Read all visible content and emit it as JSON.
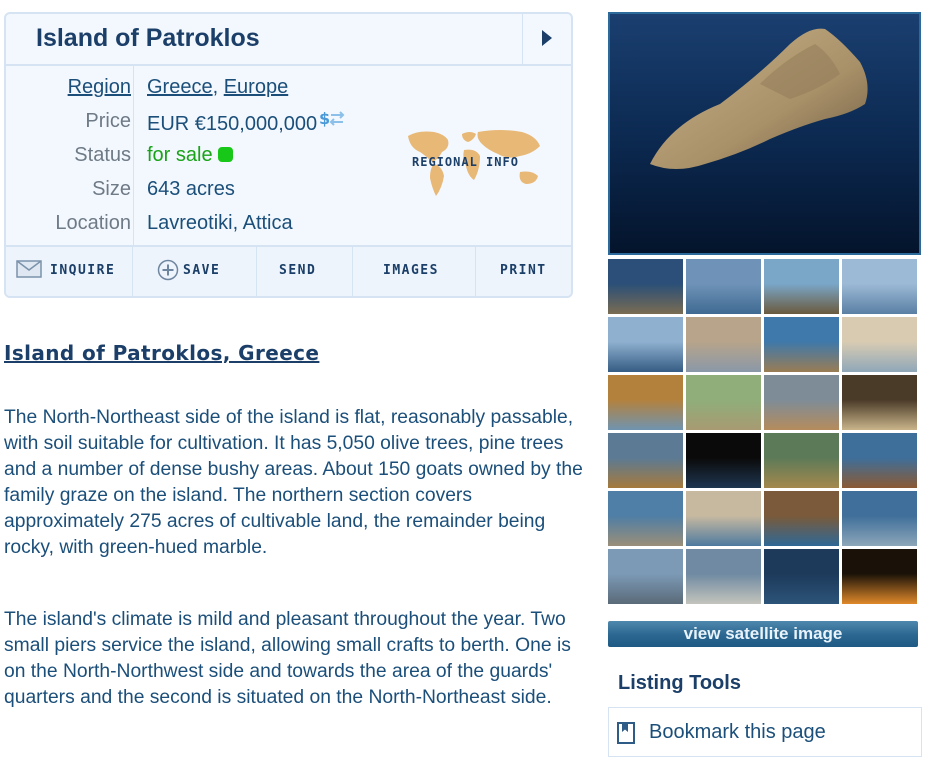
{
  "listing": {
    "title": "Island of Patroklos",
    "fields": {
      "region_label": "Region",
      "region_country": "Greece",
      "region_separator": ", ",
      "region_continent": "Europe",
      "price_label": "Price",
      "price_value": "EUR €150,000,000",
      "status_label": "Status",
      "status_value": "for sale",
      "size_label": "Size",
      "size_value": "643 acres",
      "location_label": "Location",
      "location_value": "Lavreotiki, Attica"
    },
    "regional_info_label": "REGIONAL INFO",
    "toolbar": {
      "inquire": "INQUIRE",
      "save": "SAVE",
      "send": "SEND",
      "images": "IMAGES",
      "print": "PRINT"
    }
  },
  "article": {
    "title": "Island of Patroklos, Greece",
    "paragraphs": [
      "The North-Northeast side of the island is flat, reasonably passable, with soil suitable for cultivation. It has 5,050 olive trees, pine trees and a number of dense bushy areas. About 150 goats owned by the family graze on the island. The northern section covers approximately 275 acres of cultivable land, the remainder being rocky, with green-hued marble.",
      "The island's climate is mild and pleasant throughout the year. Two small piers service the island, allowing small crafts to berth. One is on the North-Northwest side and towards the area of the guards' quarters and the second is situated on the North-Northeast side."
    ]
  },
  "gallery": {
    "thumbnail_count": 24,
    "satellite_button": "view satellite image"
  },
  "listing_tools": {
    "title": "Listing Tools",
    "bookmark": "Bookmark this page"
  },
  "colors": {
    "heading": "#1b3f68",
    "text": "#1b4f7a",
    "label_gray": "#6e7a86",
    "for_sale_green": "#18a318",
    "panel_bg": "#f3f8fe",
    "panel_border": "#d5e3f2",
    "satellite_button": "#2a6690"
  }
}
